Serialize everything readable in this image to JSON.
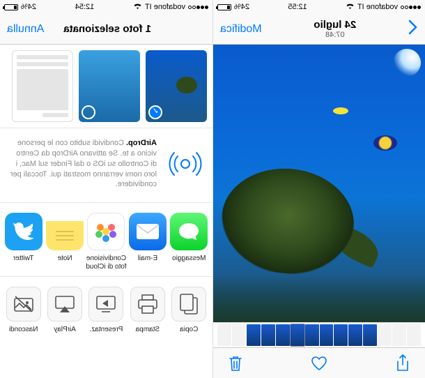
{
  "left": {
    "status": {
      "carrier": "vodafone IT",
      "time": "12:55",
      "battery_pct": "24%"
    },
    "nav": {
      "title": "24 luglio",
      "subtitle": "07:48",
      "edit": "Modifica"
    },
    "toolbar": {
      "share": "share",
      "heart": "favorite",
      "trash": "delete"
    }
  },
  "right": {
    "status": {
      "carrier": "vodafone IT",
      "time": "12:54",
      "battery_pct": "24%"
    },
    "nav": {
      "title": "1 foto selezionata",
      "cancel": "Annulla"
    },
    "airdrop": {
      "title": "AirDrop.",
      "body": "Condividi subito con le persone vicino a te. Se attivano AirDrop da Centro di Controllo su iOS o dal Finder sul Mac, i loro nomi verranno mostrati qui. Toccali per condividere."
    },
    "apps": [
      {
        "id": "message",
        "label": "Messaggio"
      },
      {
        "id": "mail",
        "label": "E-mail"
      },
      {
        "id": "icloud",
        "label": "Condivisione foto di iCloud"
      },
      {
        "id": "notes",
        "label": "Note"
      },
      {
        "id": "twitter",
        "label": "Twitter"
      }
    ],
    "actions": [
      {
        "id": "copy",
        "label": "Copia"
      },
      {
        "id": "print",
        "label": "Stampa"
      },
      {
        "id": "slideshow",
        "label": "Presentaz."
      },
      {
        "id": "airplay",
        "label": "AirPlay"
      },
      {
        "id": "hide",
        "label": "Nascondi"
      }
    ]
  },
  "colors": {
    "tint": "#007aff"
  }
}
